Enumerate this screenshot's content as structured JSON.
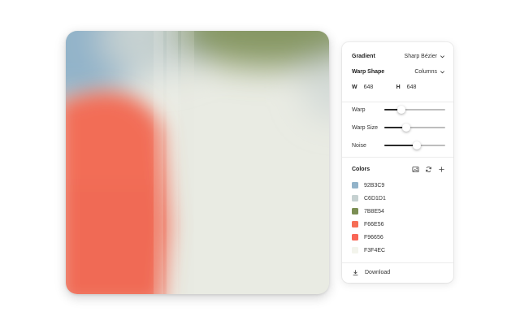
{
  "panel": {
    "gradient_label": "Gradient",
    "gradient_value": "Sharp Bézier",
    "warp_shape_label": "Warp Shape",
    "warp_shape_value": "Columns",
    "width_label": "W",
    "width_value": "648",
    "height_label": "H",
    "height_value": "648",
    "sliders": [
      {
        "label": "Warp",
        "value": 0.28
      },
      {
        "label": "Warp Size",
        "value": 0.36
      },
      {
        "label": "Noise",
        "value": 0.53
      }
    ],
    "colors_label": "Colors",
    "colors": [
      {
        "hex": "92B3C9",
        "swatch": "#92B3C9"
      },
      {
        "hex": "C6D1D1",
        "swatch": "#C6D1D1"
      },
      {
        "hex": "7B8E54",
        "swatch": "#7B8E54"
      },
      {
        "hex": "F66E56",
        "swatch": "#F66E56"
      },
      {
        "hex": "F96656",
        "swatch": "#F96656"
      },
      {
        "hex": "F3F4EC",
        "swatch": "#F3F4EC"
      }
    ],
    "download_label": "Download"
  }
}
